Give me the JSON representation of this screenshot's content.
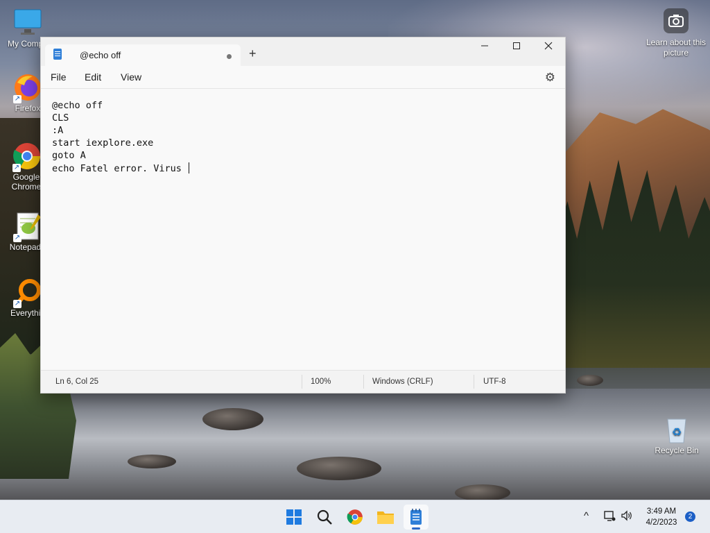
{
  "desktop": {
    "icons": [
      {
        "label": "My Compu"
      },
      {
        "label": "Firefox"
      },
      {
        "label": "Google Chrome"
      },
      {
        "label": "Notepad+"
      },
      {
        "label": "Everythin"
      },
      {
        "label": "Recycle Bin"
      }
    ],
    "learn_about": "Learn about this picture"
  },
  "notepad": {
    "tab_title": "@echo off",
    "new_tab_symbol": "+",
    "menus": [
      "File",
      "Edit",
      "View"
    ],
    "lines": [
      "@echo off",
      "CLS",
      ":A",
      "start iexplore.exe",
      "goto A",
      "echo Fatel error. Virus "
    ],
    "status": {
      "position": "Ln 6, Col 25",
      "zoom": "100%",
      "line_ending": "Windows (CRLF)",
      "encoding": "UTF-8"
    }
  },
  "taskbar": {
    "time": "3:49 AM",
    "date": "4/2/2023",
    "notification_count": "2"
  },
  "colors": {
    "accent": "#2b69c9",
    "notepad_icon": "#2f7fd8"
  }
}
